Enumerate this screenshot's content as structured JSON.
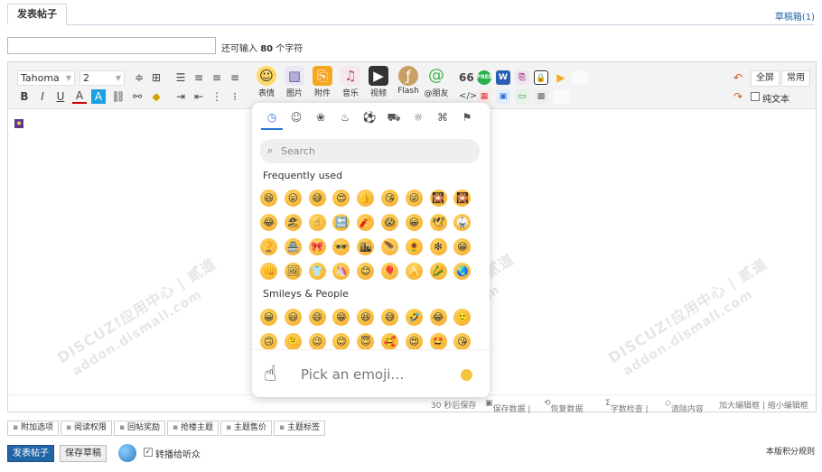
{
  "header": {
    "tab_active": "发表帖子",
    "drafts": "草稿箱(1)"
  },
  "title_field": {
    "value": "",
    "hint_prefix": "还可输入",
    "hint_count": "80",
    "hint_suffix": "个字符"
  },
  "toolbar": {
    "font": "Tahoma",
    "size": "2",
    "big_buttons": [
      {
        "icon": "smiley-icon",
        "label": "表情"
      },
      {
        "icon": "image-icon",
        "label": "图片"
      },
      {
        "icon": "attachment-icon",
        "label": "附件"
      },
      {
        "icon": "music-icon",
        "label": "音乐"
      },
      {
        "icon": "video-icon",
        "label": "视频"
      },
      {
        "icon": "flash-icon",
        "label": "Flash"
      },
      {
        "icon": "mention-icon",
        "label": "@朋友"
      }
    ],
    "fullscreen": "全屏",
    "common": "常用",
    "plain_text": "纯文本"
  },
  "status": {
    "autosave": "30 秒后保存",
    "save_data": "保存数据 |",
    "restore_data": "恢复数据",
    "word_check": "字数检查 |",
    "clear": "清除内容",
    "enlarge": "加大编辑框 | 缩小编辑框"
  },
  "picker": {
    "search_placeholder": "Search",
    "section_frequent": "Frequently used",
    "section_smileys": "Smileys & People",
    "preview_text": "Pick an emoji…",
    "frequent": [
      "😆",
      "😛",
      "😅",
      "😍",
      "👍",
      "😘",
      "😜",
      "🎇",
      "🎇",
      "😂",
      "🏖",
      "☝",
      "🔚",
      "🧨",
      "😱",
      "😀",
      "🕊",
      "🥋",
      "🏆",
      "🏯",
      "🎀",
      "🕶",
      "🏙",
      "🪶",
      "🌻",
      "❇",
      "😁",
      "👊",
      "🖼",
      "👕",
      "🦄",
      "😊",
      "🎈",
      "🍌",
      "🌽",
      "🌏"
    ],
    "smileys": [
      "😀",
      "😃",
      "😄",
      "😁",
      "😆",
      "😅",
      "🤣",
      "😂",
      "🙂",
      "🙃",
      "🫠",
      "😉",
      "😊",
      "😇",
      "🥰",
      "😍",
      "🤩",
      "😘"
    ]
  },
  "options": [
    "附加选项",
    "阅读权限",
    "回帖奖励",
    "抢楼主题",
    "主题售价",
    "主题标签"
  ],
  "footer": {
    "submit": "发表帖子",
    "save_draft": "保存草稿",
    "broadcast": "转播给听众",
    "rules": "本版积分规则"
  },
  "watermark": {
    "text_a": "DISCUZ!应用中心 | 贰道",
    "text_b": "addon.dismall.com"
  }
}
